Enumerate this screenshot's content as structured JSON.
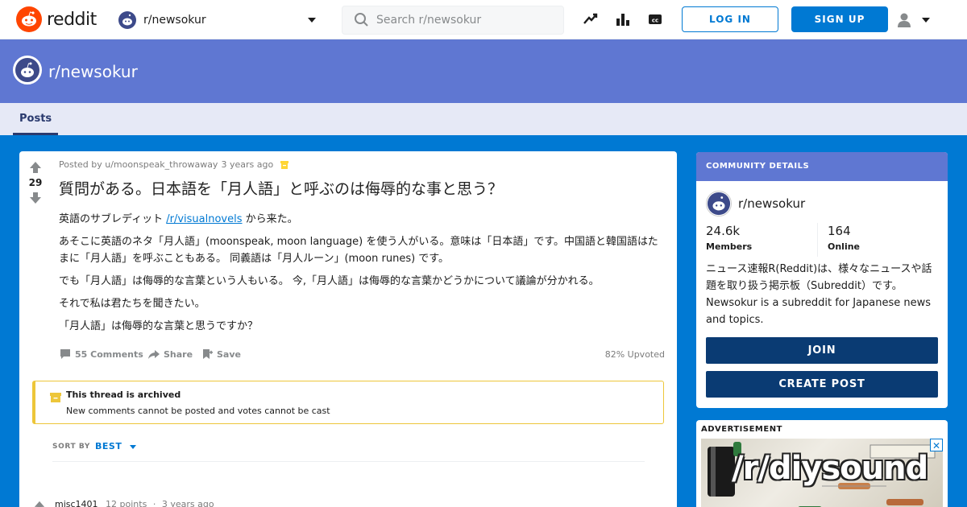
{
  "header": {
    "logo_text": "reddit",
    "community": "r/newsokur",
    "search_placeholder": "Search r/newsokur",
    "login_label": "LOG IN",
    "signup_label": "SIGN UP"
  },
  "banner": {
    "title": "r/newsokur"
  },
  "tabs": {
    "posts": "Posts"
  },
  "post": {
    "votes": "29",
    "posted_by": "Posted by u/moonspeak_throwaway",
    "time": "3 years ago",
    "title": "質問がある。日本語を「月人語」と呼ぶのは侮辱的な事と思う？",
    "p1_before": "英語のサブレディット ",
    "p1_link": "/r/visualnovels",
    "p1_after": " から来た。",
    "p2": "あそこに英語のネタ「月人語」(moonspeak, moon language) を使う人がいる。意味は「日本語」です。中国語と韓国語はたまに「月人語」を呼ぶこともある。 同義語は「月人ルーン」(moon runes) です。",
    "p3": "でも「月人語」は侮辱的な言葉という人もいる。 今,「月人語」は侮辱的な言葉かどうかについて議論が分かれる。",
    "p4": "それで私は君たちを聞きたい。",
    "p5": "「月人語」は侮辱的な言葉と思うですか？",
    "comments_label": "55 Comments",
    "share_label": "Share",
    "save_label": "Save",
    "upvoted": "82% Upvoted"
  },
  "archived": {
    "title": "This thread is archived",
    "text": "New comments cannot be posted and votes cannot be cast"
  },
  "sort": {
    "label": "SORT BY",
    "value": "BEST"
  },
  "comment": {
    "user": "misc1401",
    "points": "12 points",
    "time": "3 years ago"
  },
  "sidebar": {
    "heading": "COMMUNITY DETAILS",
    "community": "r/newsokur",
    "members_value": "24.6k",
    "members_label": "Members",
    "online_value": "164",
    "online_label": "Online",
    "description": "ニュース速報R(Reddit)は、様々なニュースや話題を取り扱う掲示板（Subreddit）です。Newsokur is a subreddit for Japanese news and topics.",
    "join_label": "JOIN",
    "create_label": "CREATE POST"
  },
  "ad": {
    "label": "ADVERTISEMENT",
    "image_text": "/r/diysound",
    "close": "✕"
  },
  "colors": {
    "brand": "#ff4500",
    "accent": "#0079d3",
    "banner": "#5f77d2",
    "archived_border": "#edc63a"
  }
}
